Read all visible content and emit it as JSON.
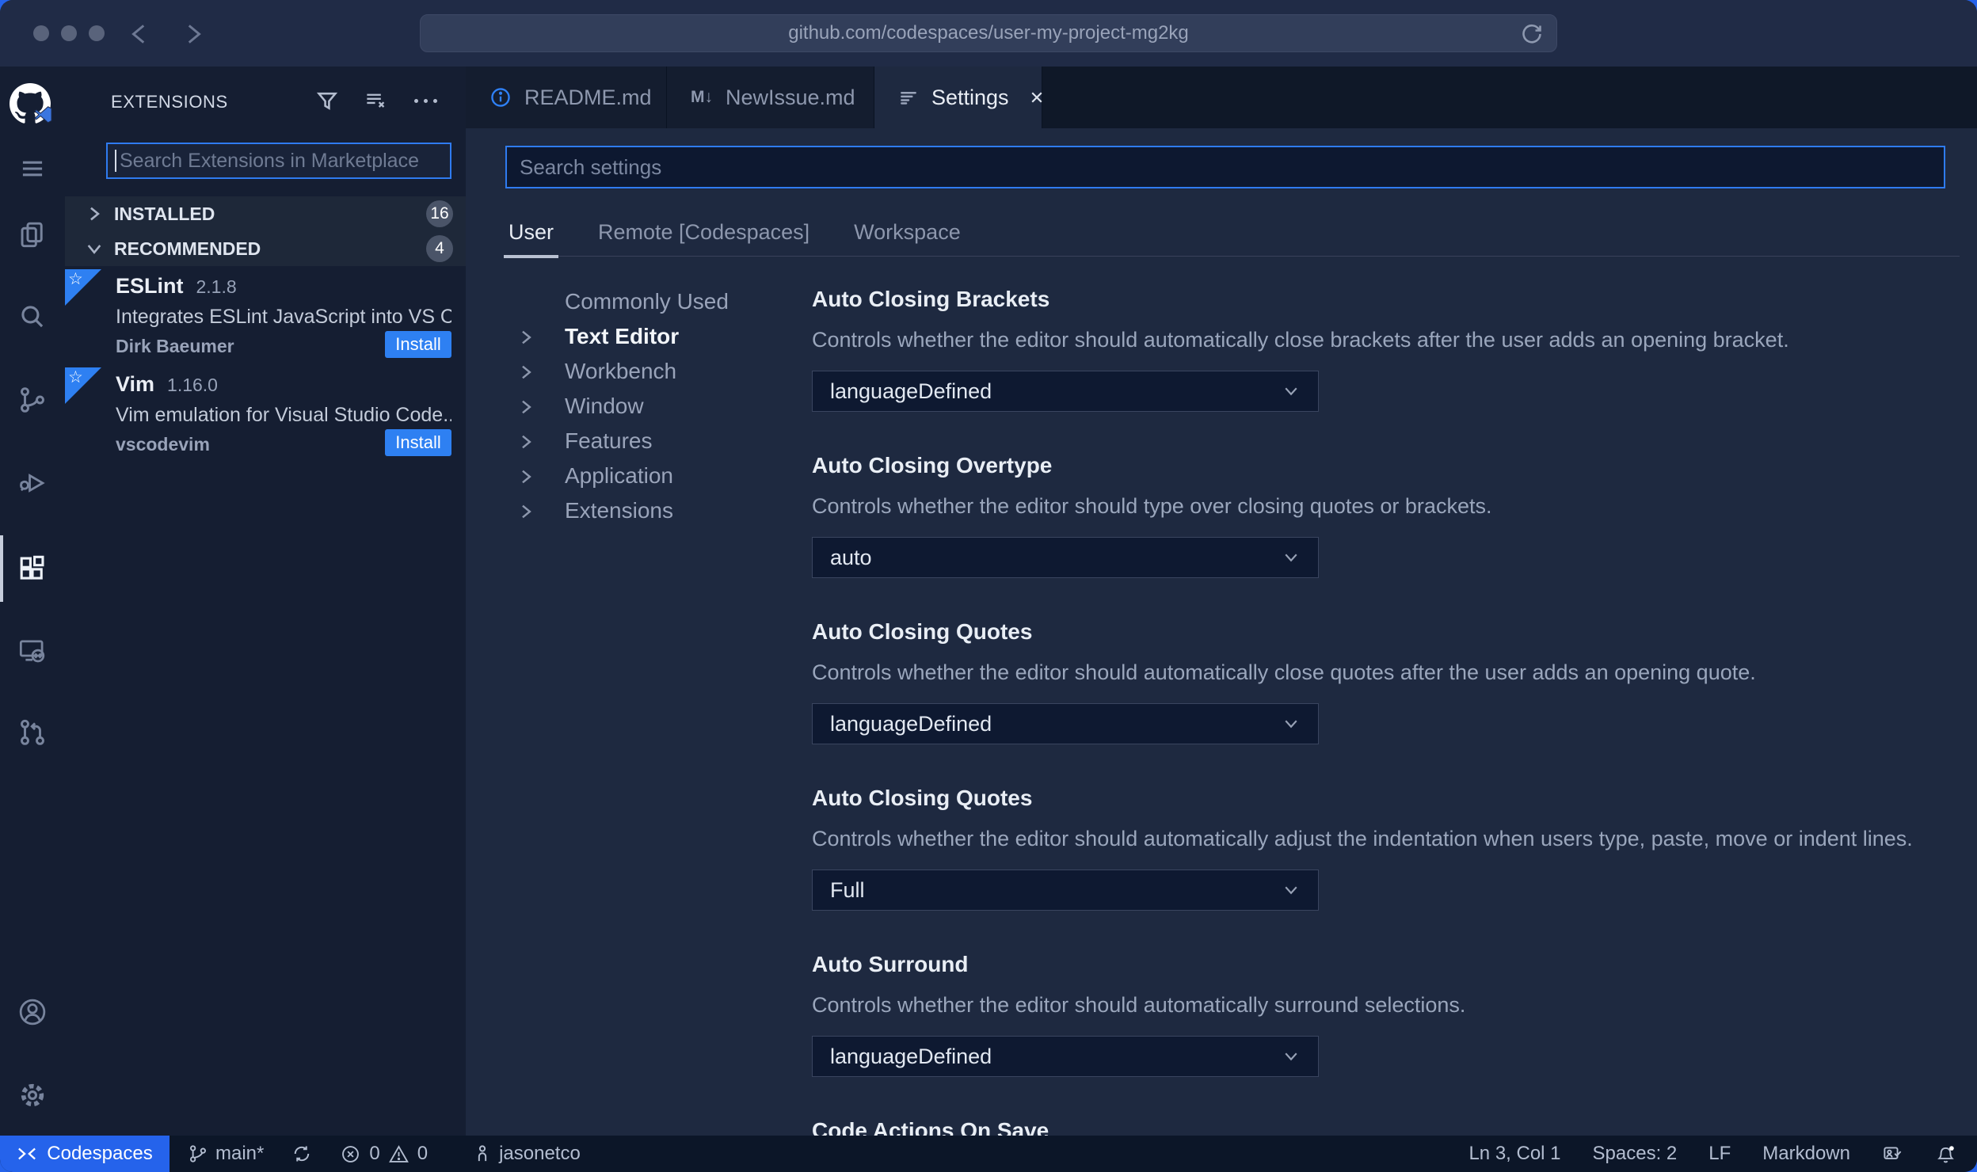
{
  "browser": {
    "url": "github.com/codespaces/user-my-project-mg2kg"
  },
  "extensions_panel": {
    "title": "EXTENSIONS",
    "search_placeholder": "Search Extensions in Marketplace",
    "sections": {
      "installed": {
        "label": "INSTALLED",
        "count": "16"
      },
      "recommended": {
        "label": "RECOMMENDED",
        "count": "4"
      }
    },
    "items": [
      {
        "name": "ESLint",
        "version": "2.1.8",
        "description": "Integrates ESLint JavaScript into VS C...",
        "author": "Dirk Baeumer",
        "action": "Install"
      },
      {
        "name": "Vim",
        "version": "1.16.0",
        "description": "Vim emulation for Visual Studio Code...",
        "author": "vscodevim",
        "action": "Install"
      }
    ]
  },
  "editor_tabs": [
    {
      "label": "README.md"
    },
    {
      "label": "NewIssue.md"
    },
    {
      "label": "Settings"
    }
  ],
  "settings_page": {
    "search_placeholder": "Search settings",
    "scopes": [
      {
        "label": "User"
      },
      {
        "label": "Remote [Codespaces]"
      },
      {
        "label": "Workspace"
      }
    ],
    "tree": [
      {
        "label": "Commonly Used"
      },
      {
        "label": "Text Editor"
      },
      {
        "label": "Workbench"
      },
      {
        "label": "Window"
      },
      {
        "label": "Features"
      },
      {
        "label": "Application"
      },
      {
        "label": "Extensions"
      }
    ],
    "entries": [
      {
        "title": "Auto Closing Brackets",
        "description": "Controls whether the editor should automatically close brackets after the user adds an opening bracket.",
        "value": "languageDefined"
      },
      {
        "title": "Auto Closing Overtype",
        "description": "Controls whether the editor should type over closing quotes or brackets.",
        "value": "auto"
      },
      {
        "title": "Auto Closing Quotes",
        "description": "Controls whether the editor should automatically close quotes after the user adds an opening quote.",
        "value": "languageDefined"
      },
      {
        "title": "Auto Closing Quotes",
        "description": "Controls whether the editor should automatically adjust the indentation when users type, paste, move or indent lines.",
        "value": "Full"
      },
      {
        "title": "Auto Surround",
        "description": "Controls whether the editor should automatically surround selections.",
        "value": "languageDefined"
      },
      {
        "title": "Code Actions On Save"
      }
    ]
  },
  "status_bar": {
    "codespaces_label": "Codespaces",
    "branch": "main*",
    "errors": "0",
    "warnings": "0",
    "user": "jasonetco",
    "cursor": "Ln 3, Col 1",
    "indent": "Spaces: 2",
    "eol": "LF",
    "language": "Markdown"
  },
  "icons": {
    "markdown_glyph": "M↓",
    "star_glyph": "☆"
  },
  "colors": {
    "accent": "#2e80f2",
    "focus_border": "#2f7bf0",
    "codespaces_bg": "#2563eb",
    "backdrop": "#2563eb"
  }
}
